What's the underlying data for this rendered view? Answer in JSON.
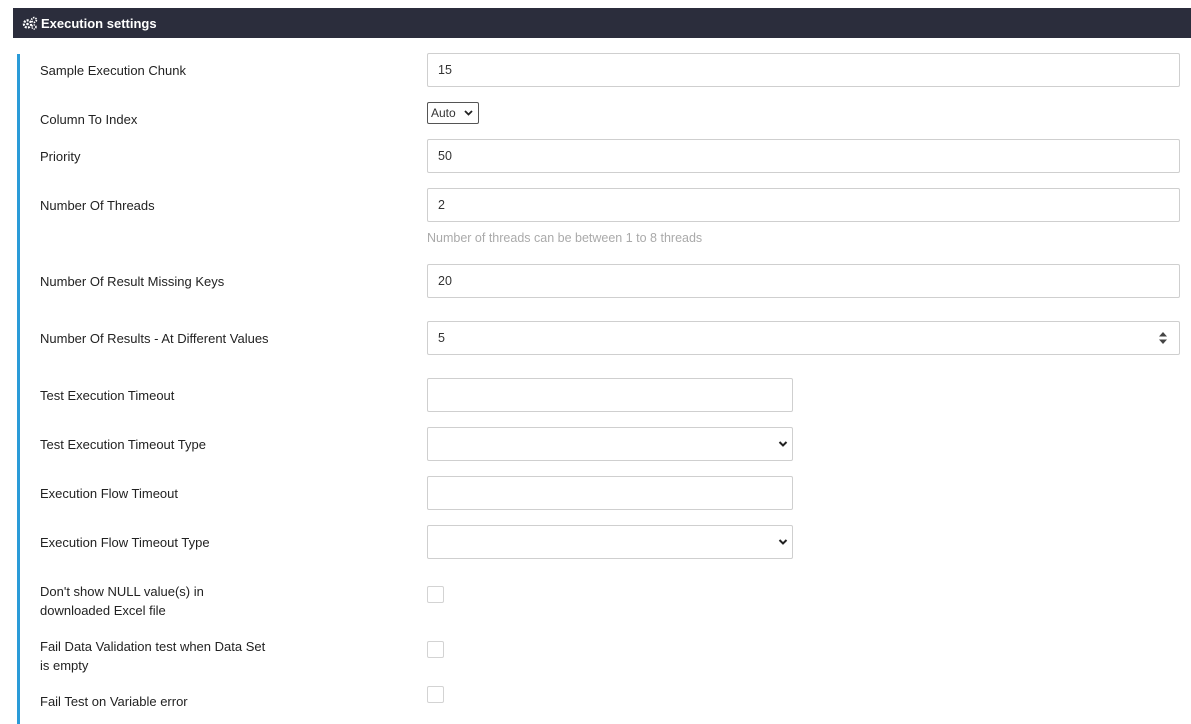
{
  "header": {
    "icon": "gears-icon",
    "title": "Execution settings"
  },
  "colors": {
    "header_bg": "#2b2d3c",
    "accent": "#2a9bd8"
  },
  "fields": {
    "sample_execution_chunk": {
      "label": "Sample Execution Chunk",
      "value": "15"
    },
    "column_to_index": {
      "label": "Column To Index",
      "value": "Auto"
    },
    "priority": {
      "label": "Priority",
      "value": "50"
    },
    "number_of_threads": {
      "label": "Number Of Threads",
      "value": "2",
      "help": "Number of threads can be between 1 to 8 threads"
    },
    "result_missing_keys": {
      "label": "Number Of Result Missing Keys",
      "value": "20"
    },
    "results_different_values": {
      "label": "Number Of Results - At Different Values",
      "value": "5"
    },
    "test_execution_timeout": {
      "label": "Test Execution Timeout",
      "value": ""
    },
    "test_execution_timeout_type": {
      "label": "Test Execution Timeout Type",
      "value": ""
    },
    "execution_flow_timeout": {
      "label": "Execution Flow Timeout",
      "value": ""
    },
    "execution_flow_timeout_type": {
      "label": "Execution Flow Timeout Type",
      "value": ""
    },
    "dont_show_null": {
      "label_line1": "Don't show NULL value(s) in",
      "label_line2": "downloaded Excel file",
      "checked": false
    },
    "fail_on_empty_dataset": {
      "label_line1": "Fail Data Validation test when Data Set",
      "label_line2": "is empty",
      "checked": false
    },
    "fail_on_variable_error": {
      "label": "Fail Test on Variable error",
      "checked": false
    }
  }
}
